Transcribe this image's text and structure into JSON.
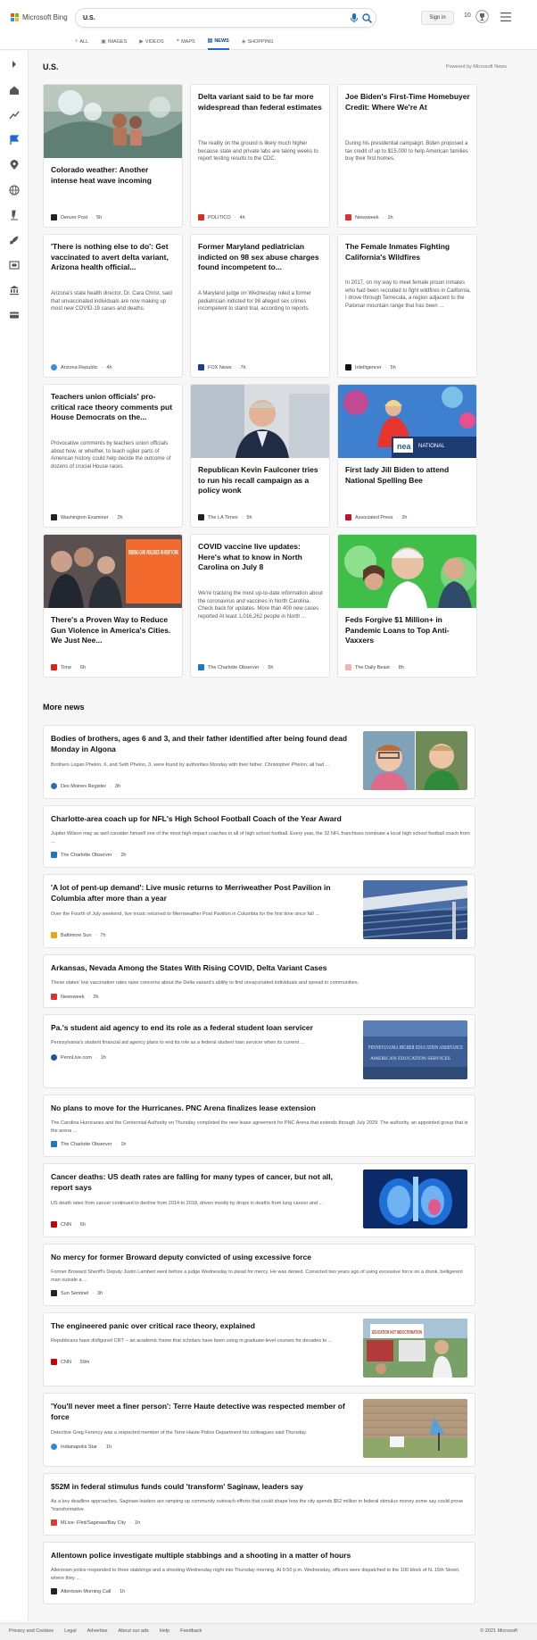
{
  "header": {
    "brand": "Microsoft Bing",
    "search_value": "U.S.",
    "sign_in": "Sign in",
    "points": "10"
  },
  "scopes": [
    {
      "label": "ALL",
      "icon": "search-icon"
    },
    {
      "label": "IMAGES",
      "icon": "image-icon"
    },
    {
      "label": "VIDEOS",
      "icon": "video-icon"
    },
    {
      "label": "MAPS",
      "icon": "map-pin-icon"
    },
    {
      "label": "NEWS",
      "icon": "news-icon",
      "active": true
    },
    {
      "label": "SHOPPING",
      "icon": "tag-icon"
    }
  ],
  "section": {
    "title": "U.S.",
    "powered": "Powered by Microsoft News"
  },
  "cards": [
    {
      "title": "Colorado weather: Another intense heat wave incoming",
      "snippet": "",
      "source": "Denver Post",
      "time": "5h"
    },
    {
      "title": "Delta variant said to be far more widespread than federal estimates",
      "snippet": "The reality on the ground is likely much higher because state and private labs are taking weeks to report testing results to the CDC.",
      "source": "POLITICO",
      "time": "4h"
    },
    {
      "title": "Joe Biden's First-Time Homebuyer Credit: Where We're At",
      "snippet": "During his presidential campaign, Biden proposed a tax credit of up to $15,000 to help American families buy their first homes.",
      "source": "Newsweek",
      "time": "1h"
    },
    {
      "title": "'There is nothing else to do': Get vaccinated to avert delta variant, Arizona health official...",
      "snippet": "Arizona's state health director, Dr. Cara Christ, said that unvaccinated individuals are now making up most new COVID-19 cases and deaths.",
      "source": "Arizona Republic",
      "time": "4h"
    },
    {
      "title": "Former Maryland pediatrician indicted on 98 sex abuse charges found incompetent to...",
      "snippet": "A Maryland judge on Wednesday ruled a former pediatrician indicted for 98 alleged sex crimes incompetent to stand trial, according to reports.",
      "source": "FOX News",
      "time": "7h"
    },
    {
      "title": "The Female Inmates Fighting California's Wildfires",
      "snippet": "In 2017, on my way to meet female prison inmates who had been recruited to fight wildfires in California, I drove through Temecula, a region adjacent to the Palomar mountain range that has been ...",
      "source": "Intelligencer",
      "time": "5h"
    },
    {
      "title": "Teachers union officials' pro-critical race theory comments put House Democrats on the...",
      "snippet": "Provocative comments by teachers union officials about how, or whether, to teach uglier parts of American history could help decide the outcome of dozens of crucial House races.",
      "source": "Washington Examiner",
      "time": "2h"
    },
    {
      "title": "Republican Kevin Faulconer tries to run his recall campaign as a policy wonk",
      "snippet": "",
      "source": "The LA Times",
      "time": "5h"
    },
    {
      "title": "First lady Jill Biden to attend National Spelling Bee",
      "snippet": "",
      "source": "Associated Press",
      "time": "2h"
    },
    {
      "title": "There's a Proven Way to Reduce Gun Violence in America's Cities. We Just Nee...",
      "snippet": "",
      "source": "Time",
      "time": "6h"
    },
    {
      "title": "COVID vaccine live updates: Here's what to know in North Carolina on July 8",
      "snippet": "We're tracking the most up-to-date information about the coronavirus and vaccines in North Carolina. Check back for updates. More than 400 new cases reported At least 1,016,262 people in North ...",
      "source": "The Charlotte Observer",
      "time": "5h"
    },
    {
      "title": "Feds Forgive $1 Million+ in Pandemic Loans to Top Anti-Vaxxers",
      "snippet": "",
      "source": "The Daily Beast",
      "time": "8h"
    }
  ],
  "image_texts": {
    "gun_sign": "ENDING GUN VIOLENCE IN NEW YORK",
    "podium": "nea",
    "podium_sub": "NATIONAL",
    "building": "PENNSYLVANIA HIGHER EDUCATION ASSISTANCE",
    "building_sub": "AMERICAN EDUCATION SERVICES",
    "protest_sign": "EDUCATION NOT INDOCTRINATION"
  },
  "more_news": {
    "title": "More news",
    "items": [
      {
        "title": "Bodies of brothers, ages 6 and 3, and their father identified after being found dead Monday in Algona",
        "snippet": "Brothers Logan Phelon, 6, and Seth Phelon, 3, were found by authorities Monday with their father, Christopher Phelon; all had ...",
        "source": "Des Moines Register",
        "time": "3h"
      },
      {
        "title": "Charlotte-area coach up for NFL's High School Football Coach of the Year Award",
        "snippet": "Jupiter Wilson may as well consider himself one of the most high-impact coaches in all of high school football. Every year, the 32 NFL franchises nominate a local high school football coach from ...",
        "source": "The Charlotte Observer",
        "time": "2h"
      },
      {
        "title": "'A lot of pent-up demand': Live music returns to Merriweather Post Pavilion in Columbia after more than a year",
        "snippet": "Over the Fourth of July weekend, live music returned to Merriweather Post Pavilion in Columbia for the first time since fall ...",
        "source": "Baltimore Sun",
        "time": "7h"
      },
      {
        "title": "Arkansas, Nevada Among the States With Rising COVID, Delta Variant Cases",
        "snippet": "These states' low vaccination rates raise concerns about the Delta variant's ability to find unvaccinated individuals and spread in communities.",
        "source": "Newsweek",
        "time": "2h"
      },
      {
        "title": "Pa.'s student aid agency to end its role as a federal student loan servicer",
        "snippet": "Pennsylvania's student financial aid agency plans to end its role as a federal student loan servicer when its current ...",
        "source": "PennLive.com",
        "time": "1h"
      },
      {
        "title": "No plans to move for the Hurricanes. PNC Arena finalizes lease extension",
        "snippet": "The Carolina Hurricanes and the Centennial Authority on Thursday completed the new lease agreement for PNC Arena that extends through July 2029. The authority, an appointed group that is the arena ...",
        "source": "The Charlotte Observer",
        "time": "1h"
      },
      {
        "title": "Cancer deaths: US death rates are falling for many types of cancer, but not all, report says",
        "snippet": "US death rates from cancer continued to decline from 2014 to 2018, driven mostly by drops in deaths from lung cancer and ...",
        "source": "CNN",
        "time": "6h"
      },
      {
        "title": "No mercy for former Broward deputy convicted of using excessive force",
        "snippet": "Former Broward Sheriff's Deputy Justin Lambert went before a judge Wednesday to plead for mercy. He was denied. Convicted two years ago of using excessive force on a drunk, belligerent man outside a ...",
        "source": "Sun Sentinel",
        "time": "3h"
      },
      {
        "title": "The engineered panic over critical race theory, explained",
        "snippet": "Republicans have disfigured CRT -- an academic frame that scholars have been using in graduate-level courses for decades to ...",
        "source": "CNN",
        "time": "59m"
      },
      {
        "title": "'You'll never meet a finer person': Terre Haute detective was respected member of force",
        "snippet": "Detective Greg Ferency was a respected member of the Terre Haute Police Department his colleagues said Thursday.",
        "source": "Indianapolis Star",
        "time": "1h"
      },
      {
        "title": "$52M in federal stimulus funds could 'transform' Saginaw, leaders say",
        "snippet": "As a key deadline approaches, Saginaw leaders are ramping up community outreach efforts that could shape how the city spends $52 million in federal stimulus money some say could prove \"transformative.",
        "source": "MLive- Flint/Saginaw/Bay City",
        "time": "1h"
      },
      {
        "title": "Allentown police investigate multiple stabbings and a shooting in a matter of hours",
        "snippet": "Allentown police responded to three stabbings and a shooting Wednesday night into Thursday morning. At 9:50 p.m. Wednesday, officers were dispatched to the 100 block of N. 15th Street, where they ...",
        "source": "Allentown Morning Call",
        "time": "1h"
      }
    ]
  },
  "footer": {
    "links": [
      "Privacy and Cookies",
      "Legal",
      "Advertise",
      "About our ads",
      "Help",
      "Feedback"
    ],
    "copyright": "© 2021 Microsoft"
  },
  "colors": {
    "accent": "#1b6bd4",
    "sidebar_icons": "#555555"
  }
}
